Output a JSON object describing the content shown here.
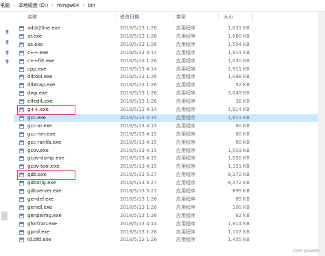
{
  "breadcrumb": [
    "电脑",
    "本地磁盘 (D:)",
    "mingw64",
    "bin"
  ],
  "columns": {
    "name": "名称",
    "date": "修改日期",
    "type": "类型",
    "size": "大小"
  },
  "files": [
    {
      "name": "addr2line.exe",
      "date": "2018/5/13 1:26",
      "type": "应用程序",
      "size": "1,031 KB"
    },
    {
      "name": "ar.exe",
      "date": "2018/5/13 1:26",
      "type": "应用程序",
      "size": "1,060 KB"
    },
    {
      "name": "as.exe",
      "date": "2018/5/13 1:26",
      "type": "应用程序",
      "size": "1,554 KB"
    },
    {
      "name": "c++.exe",
      "date": "2018/5/13 4:14",
      "type": "应用程序",
      "size": "1,914 KB"
    },
    {
      "name": "c++filt.exe",
      "date": "2018/5/13 1:26",
      "type": "应用程序",
      "size": "1,030 KB"
    },
    {
      "name": "cpp.exe",
      "date": "2018/5/13 4:14",
      "type": "应用程序",
      "size": "1,911 KB"
    },
    {
      "name": "dlltool.exe",
      "date": "2018/5/13 1:26",
      "type": "应用程序",
      "size": "1,088 KB"
    },
    {
      "name": "dllwrap.exe",
      "date": "2018/5/13 1:26",
      "type": "应用程序",
      "size": "52 KB"
    },
    {
      "name": "dwp.exe",
      "date": "2018/5/13 1:26",
      "type": "应用程序",
      "size": "3,049 KB"
    },
    {
      "name": "elfedit.exe",
      "date": "2018/5/13 1:26",
      "type": "应用程序",
      "size": "36 KB"
    },
    {
      "name": "g++.exe",
      "date": "2018/5/13 4:14",
      "type": "应用程序",
      "size": "1,914 KB"
    },
    {
      "name": "gcc.exe",
      "date": "2018/5/13 4:15",
      "type": "应用程序",
      "size": "1,911 KB"
    },
    {
      "name": "gcc-ar.exe",
      "date": "2018/5/13 4:15",
      "type": "应用程序",
      "size": "60 KB"
    },
    {
      "name": "gcc-nm.exe",
      "date": "2018/5/13 4:15",
      "type": "应用程序",
      "size": "60 KB"
    },
    {
      "name": "gcc-ranlib.exe",
      "date": "2018/5/13 4:15",
      "type": "应用程序",
      "size": "60 KB"
    },
    {
      "name": "gcov.exe",
      "date": "2018/5/13 4:15",
      "type": "应用程序",
      "size": "1,503 KB"
    },
    {
      "name": "gcov-dump.exe",
      "date": "2018/5/13 4:15",
      "type": "应用程序",
      "size": "1,050 KB"
    },
    {
      "name": "gcov-tool.exe",
      "date": "2018/5/13 4:15",
      "type": "应用程序",
      "size": "1,151 KB"
    },
    {
      "name": "gdb.exe",
      "date": "2018/5/13 5:27",
      "type": "应用程序",
      "size": "9,372 KB"
    },
    {
      "name": "gdborig.exe",
      "date": "2018/5/13 5:27",
      "type": "应用程序",
      "size": "9,372 KB"
    },
    {
      "name": "gdbserver.exe",
      "date": "2018/5/13 5:27",
      "type": "应用程序",
      "size": "895 KB"
    },
    {
      "name": "gendef.exe",
      "date": "2018/5/13 1:26",
      "type": "应用程序",
      "size": "85 KB"
    },
    {
      "name": "genidl.exe",
      "date": "2018/5/13 1:26",
      "type": "应用程序",
      "size": "100 KB"
    },
    {
      "name": "genpeimg.exe",
      "date": "2018/5/13 1:26",
      "type": "应用程序",
      "size": "62 KB"
    },
    {
      "name": "gfortran.exe",
      "date": "2018/5/13 4:14",
      "type": "应用程序",
      "size": "1,914 KB"
    },
    {
      "name": "gprof.exe",
      "date": "2018/5/13 1:26",
      "type": "应用程序",
      "size": "1,107 KB"
    },
    {
      "name": "ld.bfd.exe",
      "date": "2018/5/13 1:26",
      "type": "应用程序",
      "size": "1,455 KB"
    }
  ],
  "selected_row": "gcc.exe",
  "highlighted_rows": [
    "g++.exe",
    "gdb.exe"
  ],
  "watermark": "CSDN @llxb666",
  "colors": {
    "highlight_border": "#e23a3a",
    "selection": "#cce8ff",
    "header_text": "#4c607a"
  }
}
